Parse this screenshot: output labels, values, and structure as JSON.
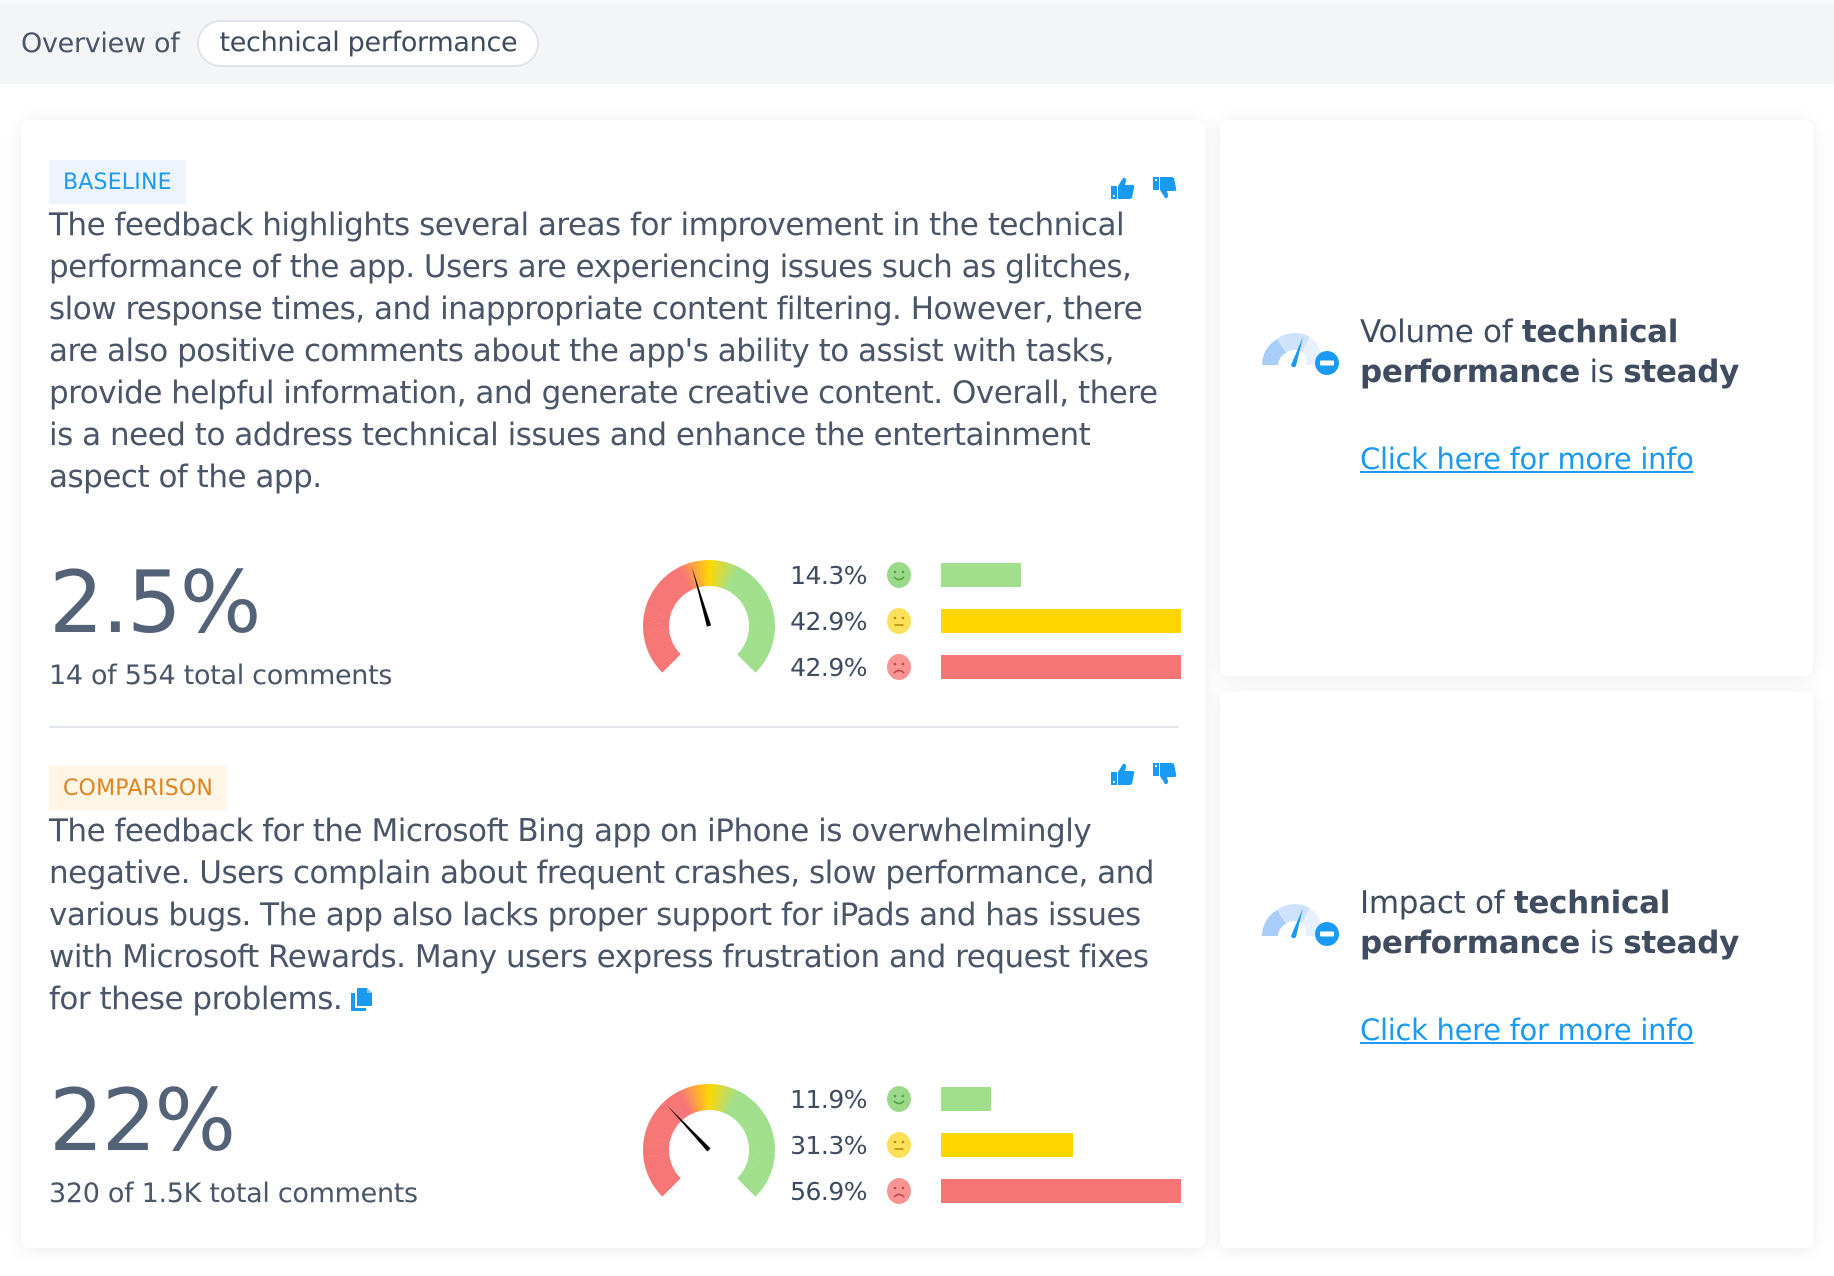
{
  "header": {
    "label": "Overview of",
    "topic": "technical performance"
  },
  "baseline": {
    "tag": "BASELINE",
    "summary": "The feedback highlights several areas for improvement in the technical performance of the app. Users are experiencing issues such as glitches, slow response times, and inappropriate content filtering. However, there are also positive comments about the app's ability to assist with tasks, provide helpful information, and generate creative content. Overall, there is a need to address technical issues and enhance the entertainment aspect of the app.",
    "share": "2.5%",
    "count_text": "14 of 554 total comments",
    "gauge_needle_fraction": 0.44,
    "sentiment": [
      {
        "label": "14.3%",
        "value": 14.3,
        "kind": "positive",
        "icon": "smile-face-icon",
        "color": "#a0df8c"
      },
      {
        "label": "42.9%",
        "value": 42.9,
        "kind": "neutral",
        "icon": "neutral-face-icon",
        "color": "#ffd600"
      },
      {
        "label": "42.9%",
        "value": 42.9,
        "kind": "negative",
        "icon": "sad-face-icon",
        "color": "#f67575"
      }
    ]
  },
  "comparison": {
    "tag": "COMPARISON",
    "summary": "The feedback for the Microsoft Bing app on iPhone is overwhelmingly negative. Users complain about frequent crashes, slow performance, and various bugs. The app also lacks proper support for iPads and has issues with Microsoft Rewards. Many users express frustration and request fixes for these problems.",
    "share": "22%",
    "count_text": "320 of 1.5K total comments",
    "gauge_needle_fraction": 0.34,
    "sentiment": [
      {
        "label": "11.9%",
        "value": 11.9,
        "kind": "positive",
        "icon": "smile-face-icon",
        "color": "#a0df8c"
      },
      {
        "label": "31.3%",
        "value": 31.3,
        "kind": "neutral",
        "icon": "neutral-face-icon",
        "color": "#ffd600"
      },
      {
        "label": "56.9%",
        "value": 56.9,
        "kind": "negative",
        "icon": "sad-face-icon",
        "color": "#f67575"
      }
    ]
  },
  "trends": [
    {
      "prefix": "Volume of ",
      "topic": "technical performance",
      "mid": " is ",
      "status": "steady",
      "link": "Click here for more info"
    },
    {
      "prefix": "Impact of ",
      "topic": "technical performance",
      "mid": " is ",
      "status": "steady",
      "link": "Click here for more info"
    }
  ],
  "colors": {
    "accent": "#1a9af2",
    "positive": "#a0df8c",
    "neutral": "#ffd600",
    "negative": "#f67575",
    "baseline_tag": "#1a9af2",
    "comparison_tag": "#dd8420"
  }
}
